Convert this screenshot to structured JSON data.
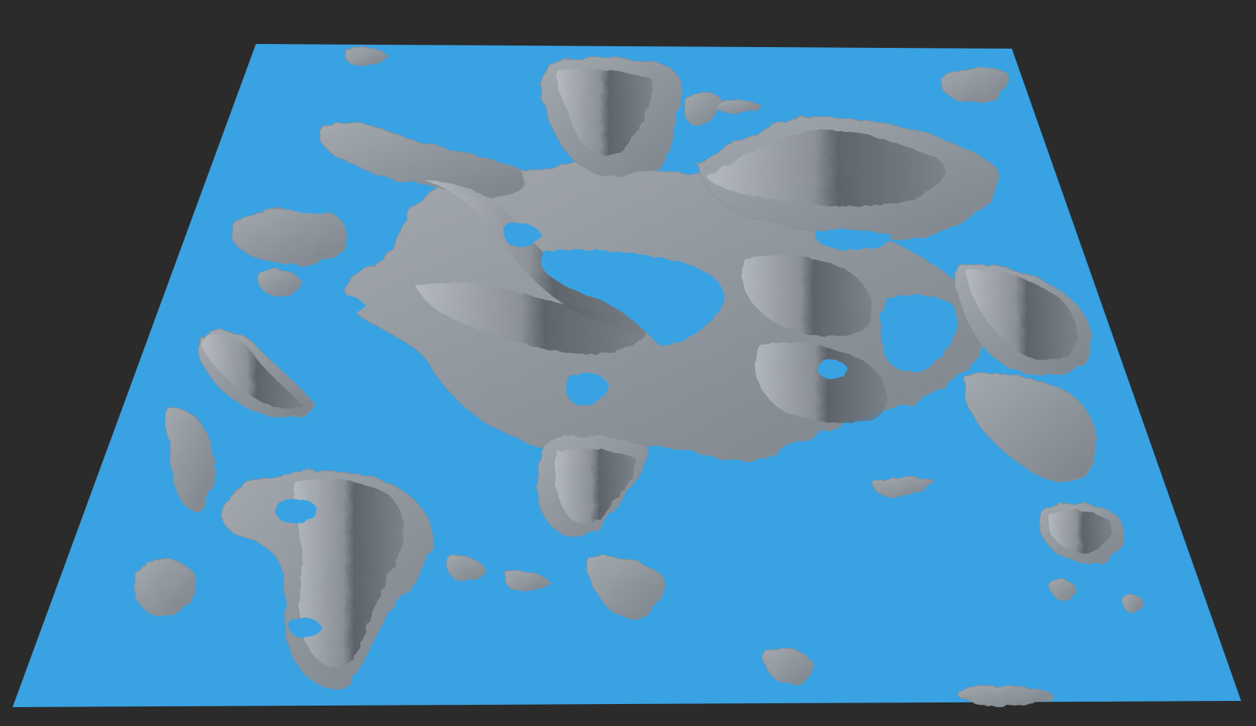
{
  "scene": {
    "background_color": "#2b2b2b",
    "water_color": "#38a2e3",
    "land_color": "#8f969d",
    "land_shadow_color": "#5e646b",
    "land_highlight_color": "#b4babf"
  }
}
